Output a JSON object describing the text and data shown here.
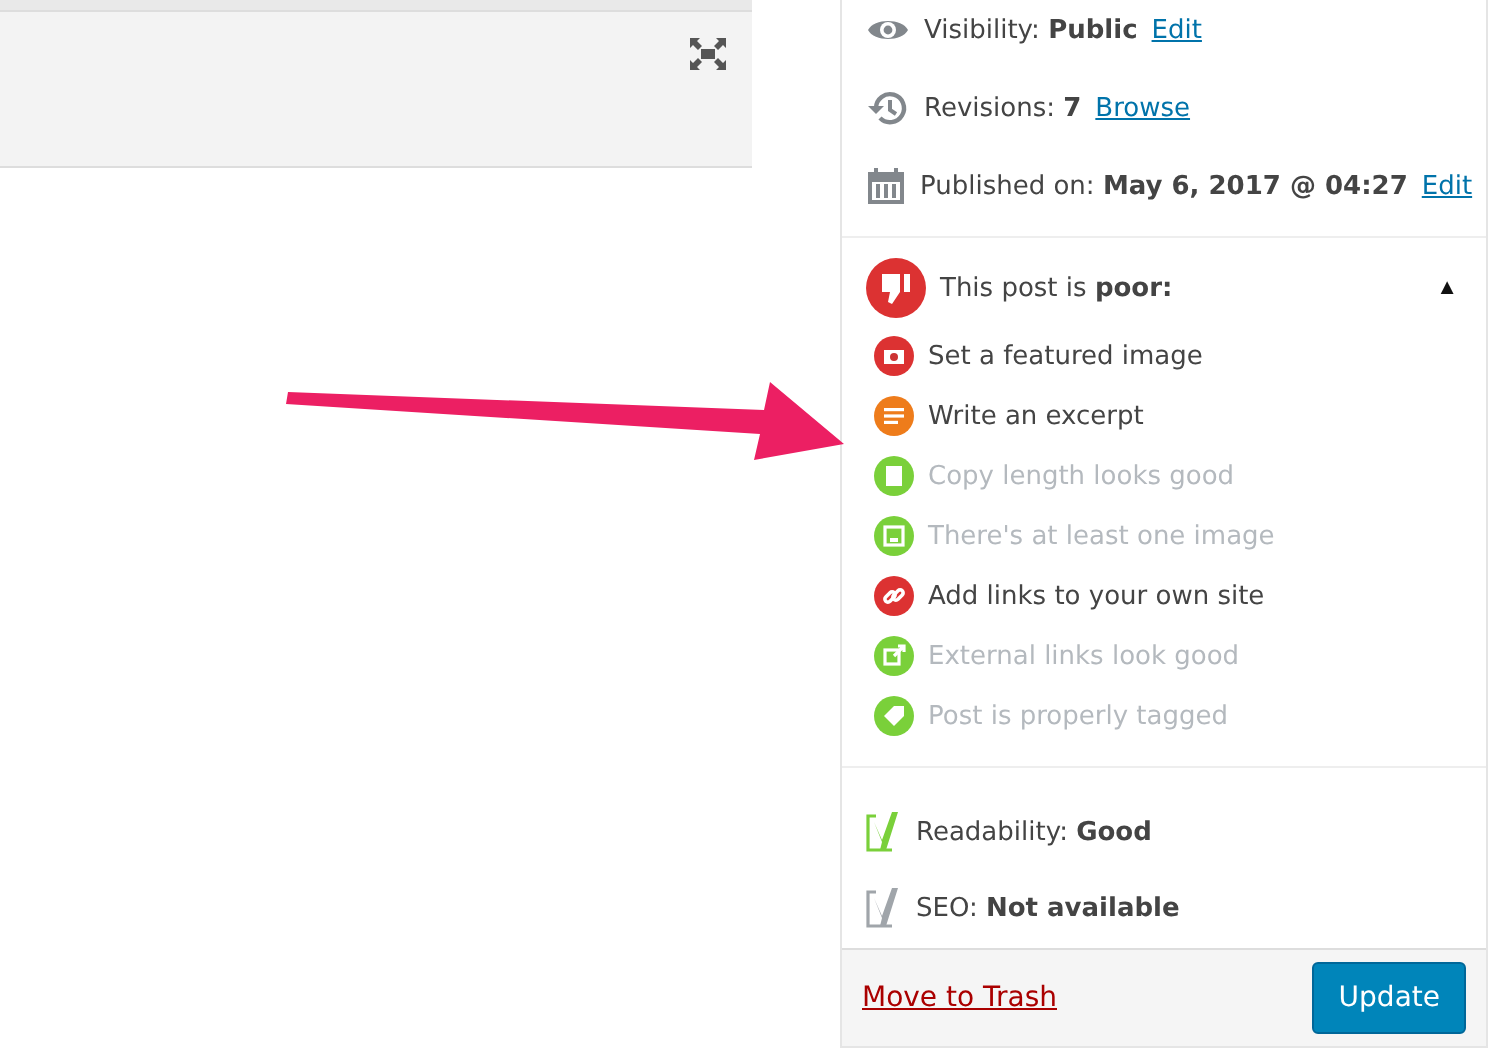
{
  "publish": [
    {
      "kind": "visibility",
      "label": "Visibility: ",
      "value": "Public",
      "link": "Edit"
    },
    {
      "kind": "revisions",
      "label": "Revisions: ",
      "value": "7",
      "link": "Browse"
    },
    {
      "kind": "date",
      "label": "Published on: ",
      "value": "May 6, 2017 @ 04:27",
      "link": "Edit"
    }
  ],
  "analysis": {
    "label": "This post is ",
    "verdict": "poor:",
    "expanded": true,
    "toggle": "▲",
    "items": [
      {
        "text": "Set a featured image",
        "color": "#dc3232",
        "dimmed": false
      },
      {
        "text": "Write an excerpt",
        "color": "#ee7c1b",
        "dimmed": false
      },
      {
        "text": "Copy length looks good",
        "color": "#7ad03a",
        "dimmed": true
      },
      {
        "text": "There's at least one image",
        "color": "#7ad03a",
        "dimmed": true
      },
      {
        "text": "Add links to your own site",
        "color": "#dc3232",
        "dimmed": false
      },
      {
        "text": "External links look good",
        "color": "#7ad03a",
        "dimmed": true
      },
      {
        "text": "Post is properly tagged",
        "color": "#7ad03a",
        "dimmed": true
      }
    ]
  },
  "scores": [
    {
      "label": "Readability: ",
      "value": "Good",
      "color": "#7ad03a"
    },
    {
      "label": "SEO: ",
      "value": "Not available",
      "color": "#a0a5aa"
    }
  ],
  "footer": {
    "trash": "Move to Trash",
    "button": "Update"
  }
}
